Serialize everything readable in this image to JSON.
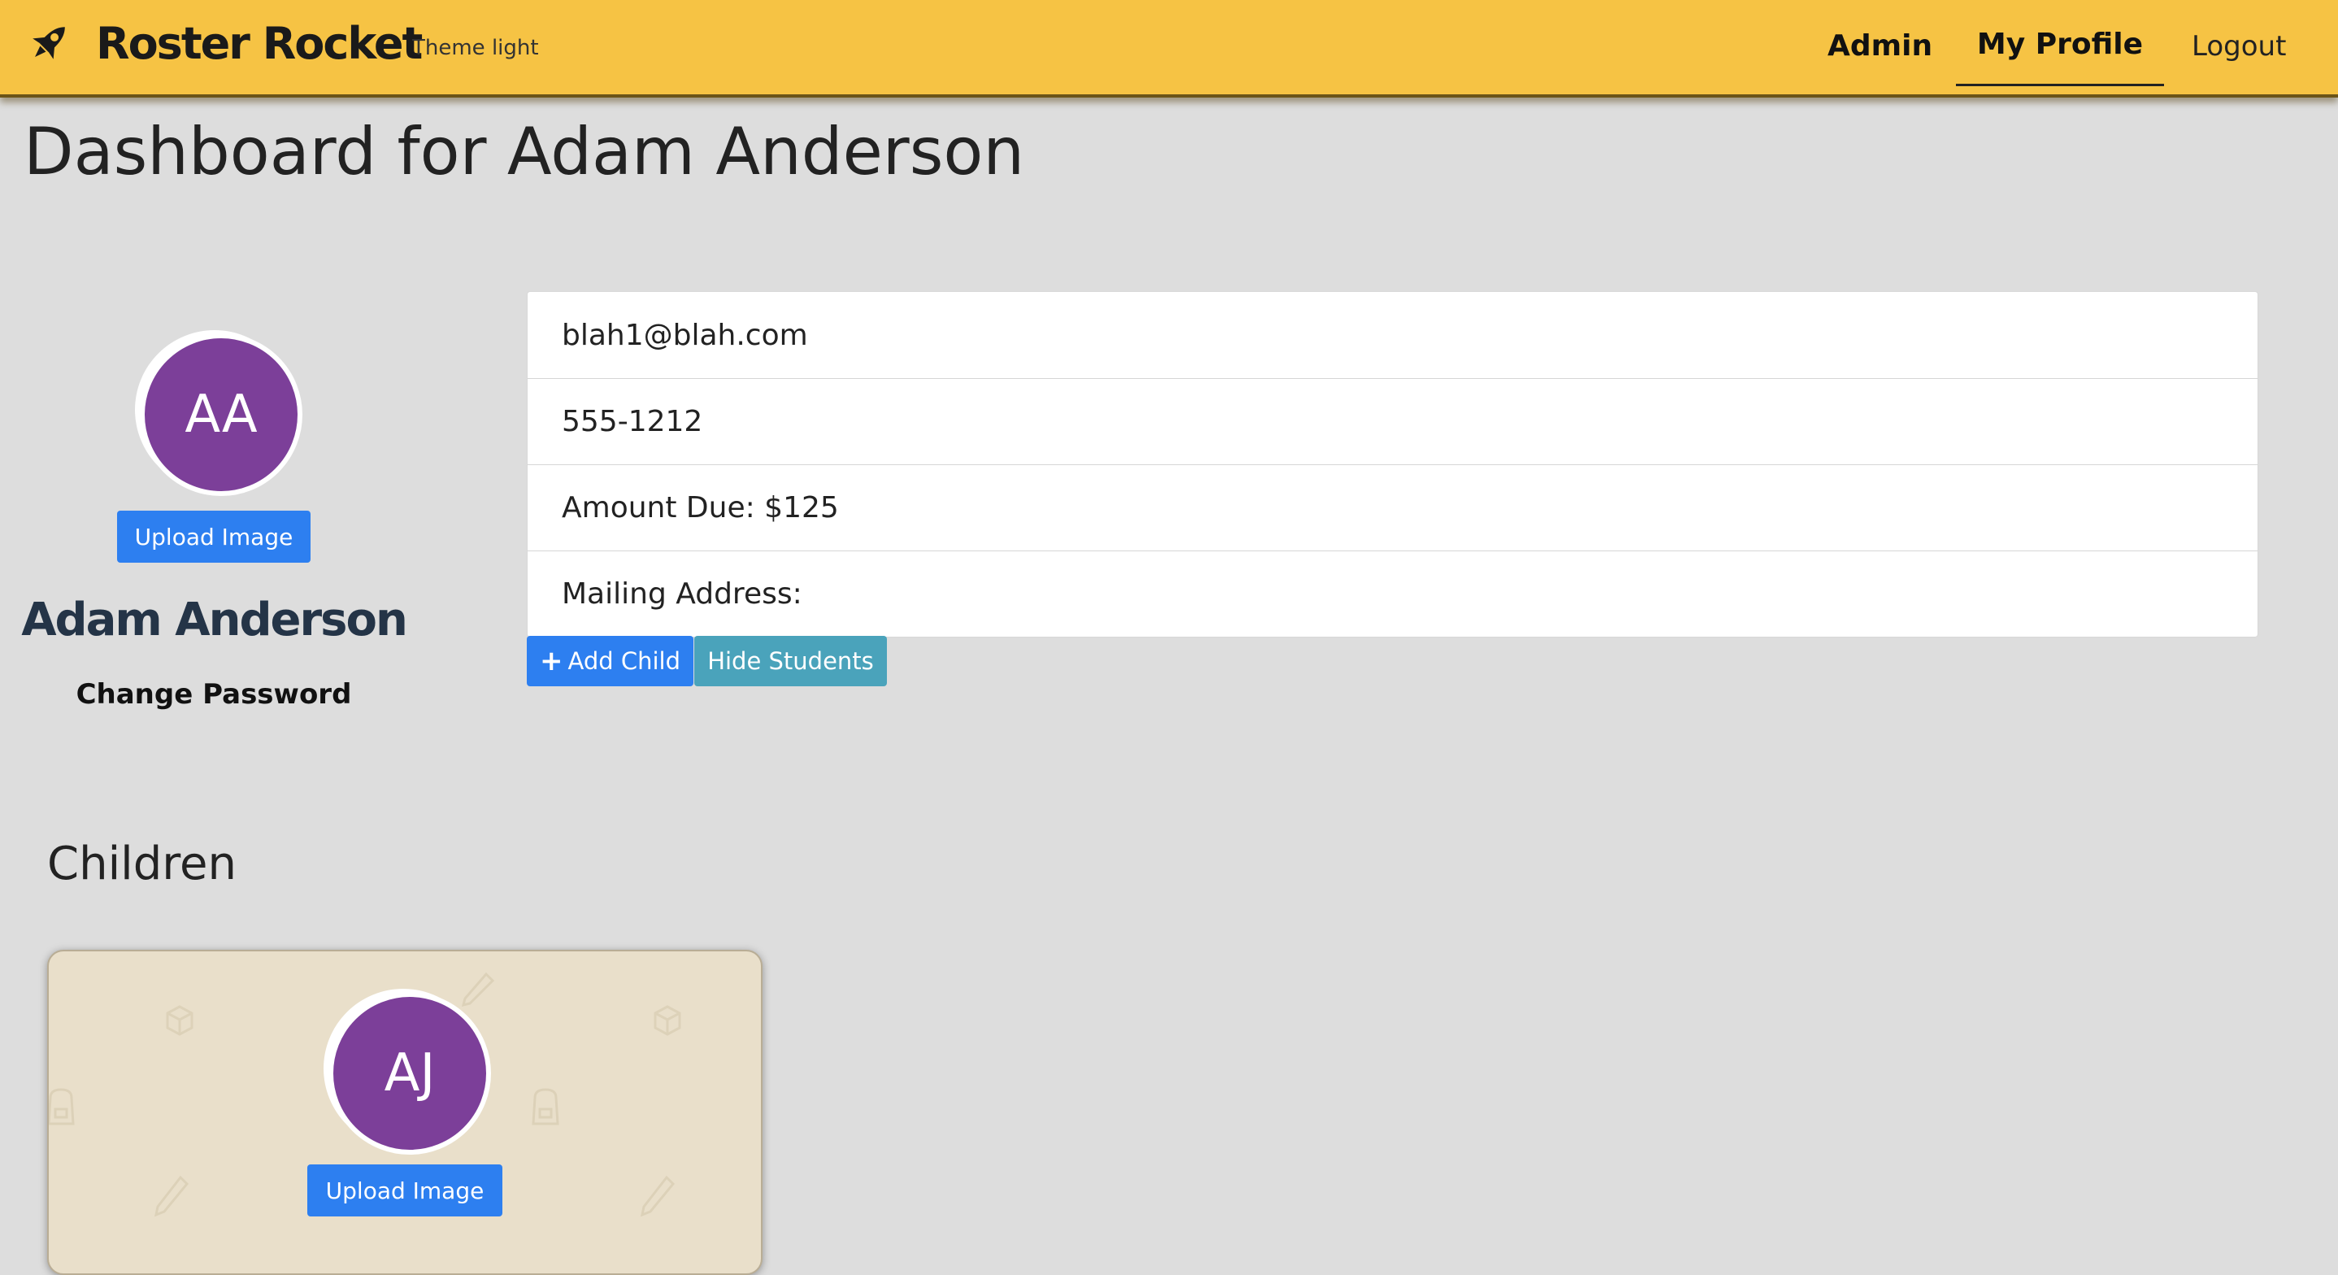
{
  "navbar": {
    "brand_name": "Roster Rocket",
    "brand_icon": "rocket-icon",
    "theme_link": "Theme light",
    "links": {
      "admin": "Admin",
      "my_profile": "My Profile",
      "logout": "Logout"
    },
    "active_link": "My Profile",
    "background_color": "#f6c344"
  },
  "page": {
    "title": "Dashboard for Adam Anderson"
  },
  "profile": {
    "initials": "AA",
    "avatar_color": "#7c3f99",
    "upload_label": "Upload Image",
    "name": "Adam Anderson",
    "change_password": "Change Password"
  },
  "info": {
    "email": "blah1@blah.com",
    "phone": "555-1212",
    "amount_due": "Amount Due: $125",
    "mailing_address": "Mailing Address:"
  },
  "actions": {
    "add_child": "Add Child",
    "hide_students": "Hide Students"
  },
  "children": {
    "heading": "Children",
    "items": [
      {
        "initials": "AJ",
        "upload_label": "Upload Image"
      }
    ]
  },
  "colors": {
    "primary_button": "#2d7ff0",
    "info_button": "#4aa3bb",
    "card_background": "#e9dfca",
    "page_background": "#dddddd"
  }
}
